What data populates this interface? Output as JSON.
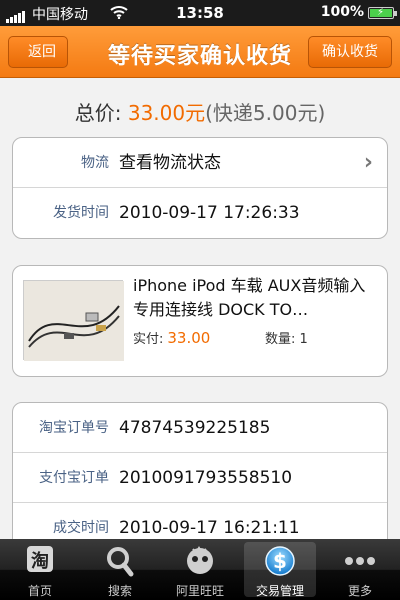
{
  "status_bar": {
    "carrier": "中国移动",
    "time": "13:58",
    "battery": "100%"
  },
  "nav": {
    "back_label": "返回",
    "title": "等待买家确认收货",
    "confirm_label": "确认收货"
  },
  "total": {
    "label": "总价: ",
    "price": "33.00元",
    "shipping": "(快递5.00元)"
  },
  "logistics": {
    "carrier_label": "物流",
    "carrier_value": "查看物流状态",
    "ship_time_label": "发货时间",
    "ship_time_value": "2010-09-17 17:26:33"
  },
  "product": {
    "title": "iPhone iPod 车载 AUX音频输入专用连接线 DOCK TO…",
    "price_label": "实付:",
    "price": "33.00",
    "qty_label": "数量: ",
    "qty": "1"
  },
  "order": {
    "taobao_no_label": "淘宝订单号",
    "taobao_no_value": "47874539225185",
    "alipay_no_label": "支付宝订单",
    "alipay_no_value": "2010091793558510",
    "deal_time_label": "成交时间",
    "deal_time_value": "2010-09-17 16:21:11"
  },
  "tabs": [
    {
      "label": "首页",
      "icon": "taobao-icon"
    },
    {
      "label": "搜索",
      "icon": "search-icon"
    },
    {
      "label": "阿里旺旺",
      "icon": "wangwang-icon"
    },
    {
      "label": "交易管理",
      "icon": "dollar-icon"
    },
    {
      "label": "更多",
      "icon": "more-icon"
    }
  ],
  "colors": {
    "accent": "#f47a12",
    "price": "#f26b00",
    "label": "#4a6285"
  }
}
